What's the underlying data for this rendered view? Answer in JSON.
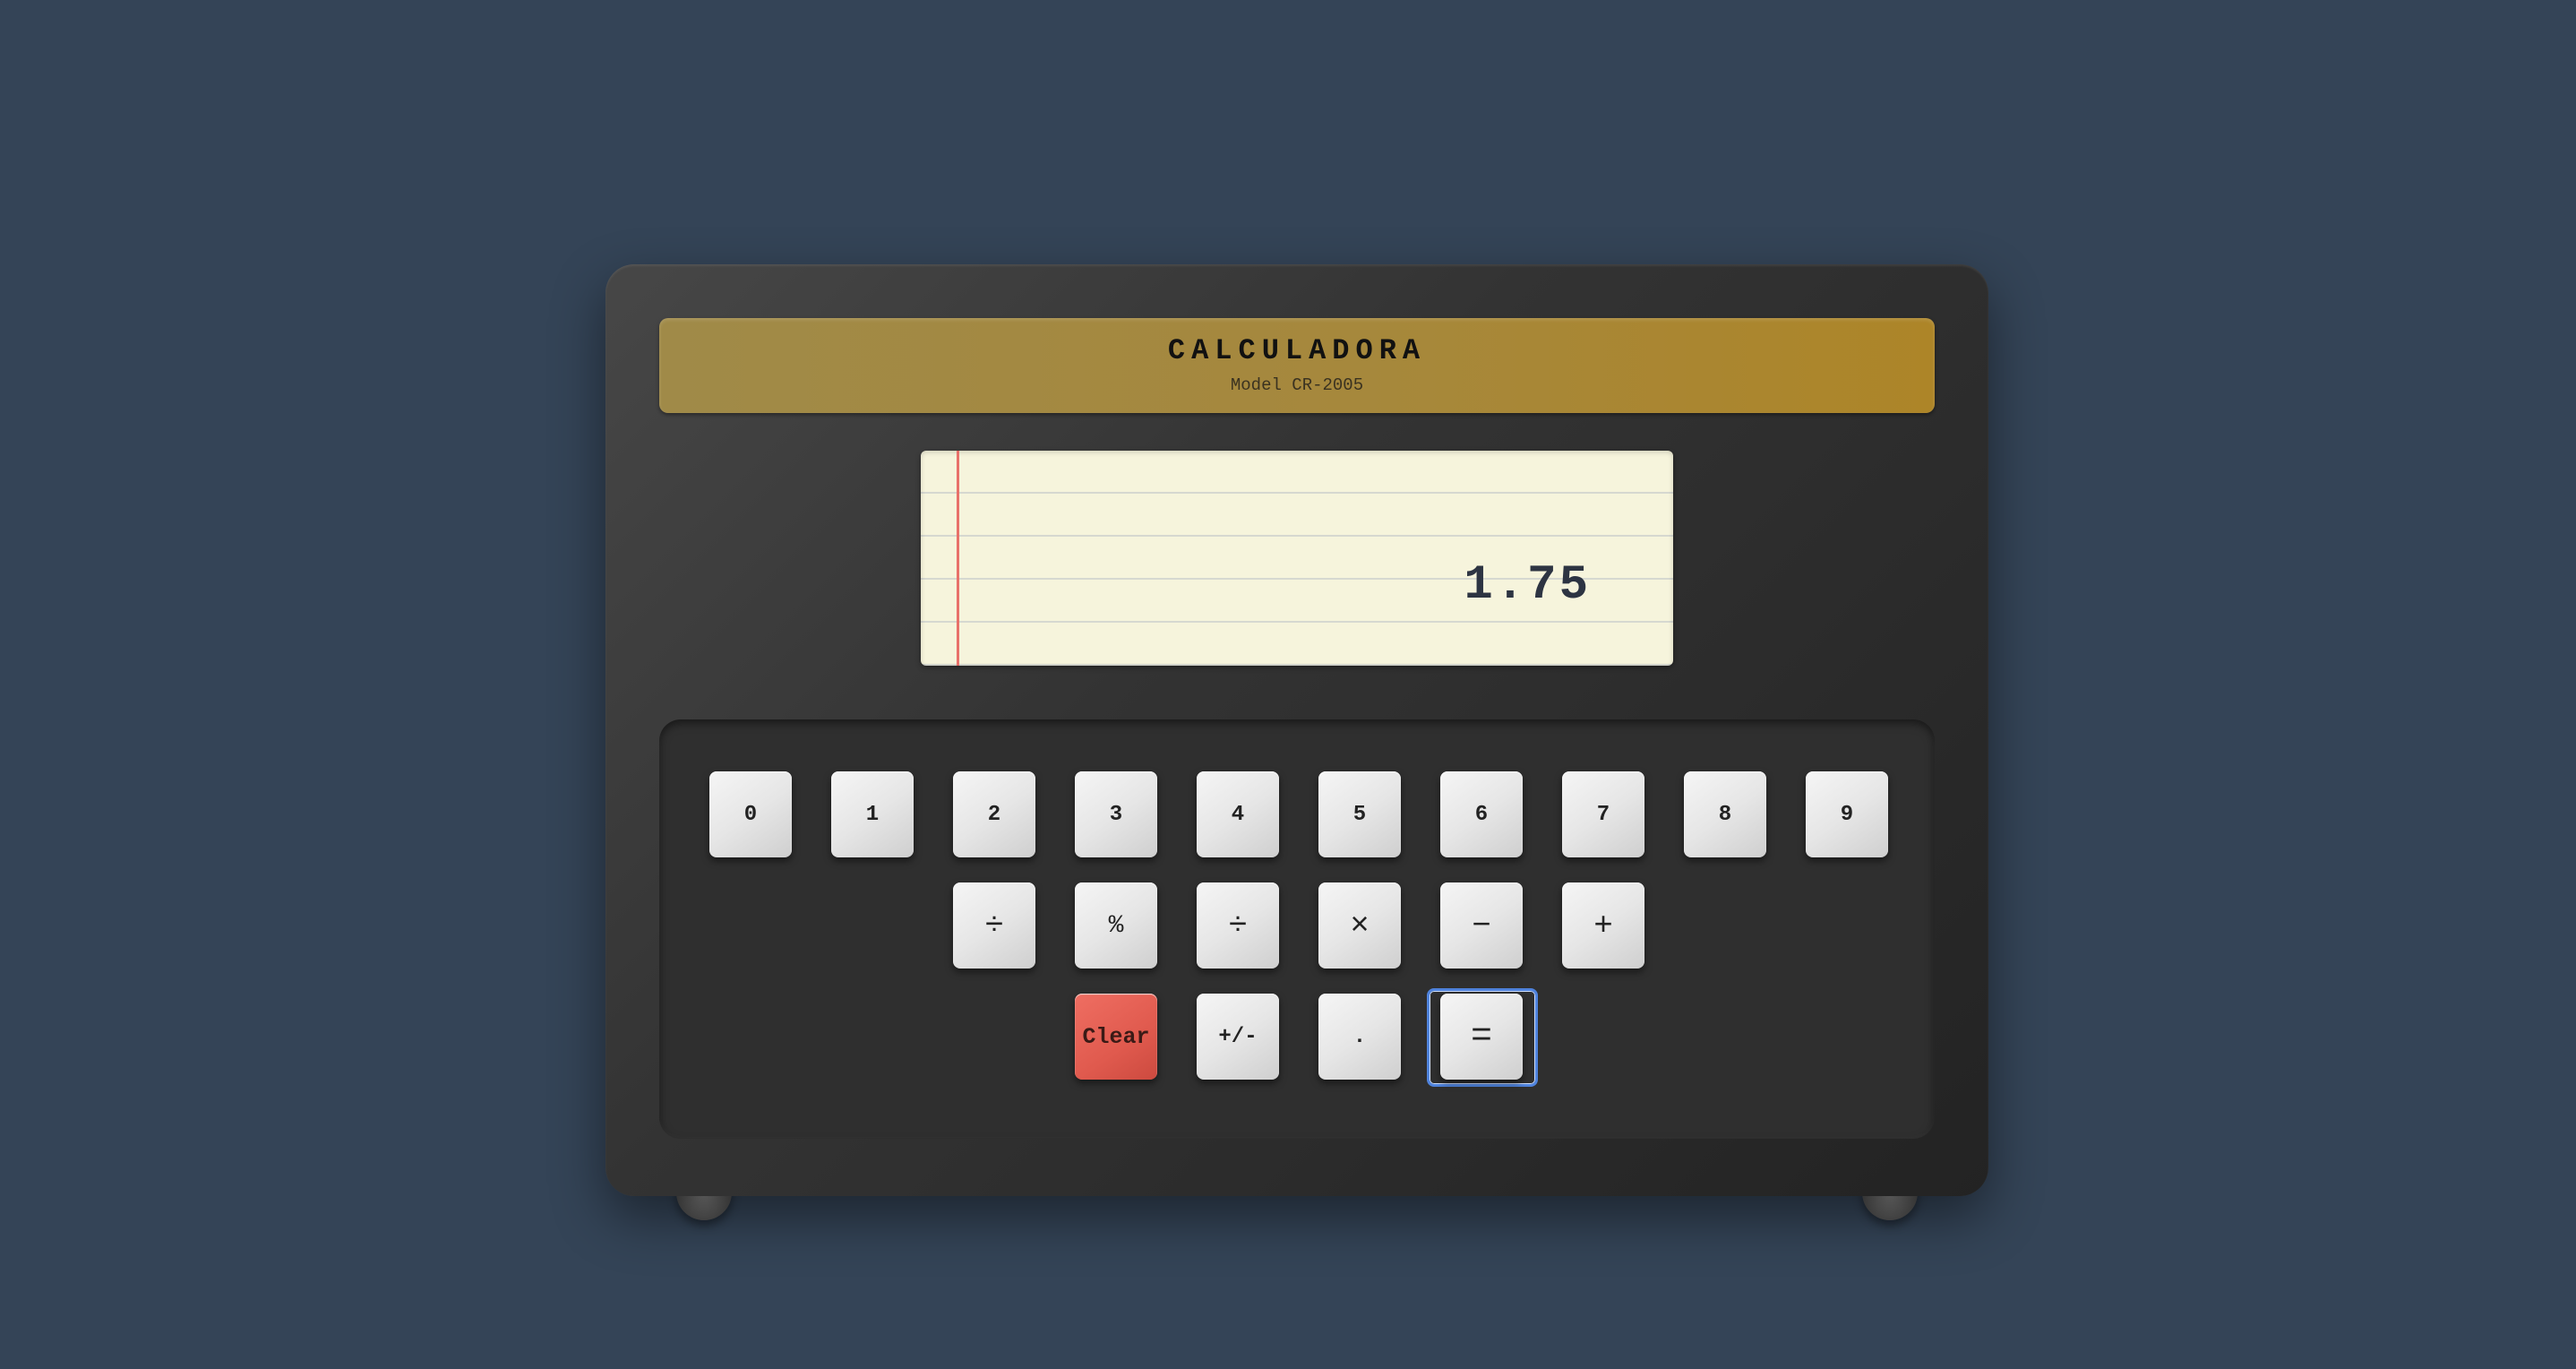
{
  "header": {
    "title": "CALCULADORA",
    "model": "Model CR-2005"
  },
  "display": {
    "value": "1.75"
  },
  "keypad": {
    "digits": [
      "0",
      "1",
      "2",
      "3",
      "4",
      "5",
      "6",
      "7",
      "8",
      "9"
    ],
    "operators": [
      "÷",
      "%",
      "÷",
      "×",
      "−",
      "+"
    ],
    "actions": {
      "clear": "Clear",
      "negate": "+/-",
      "decimal": ".",
      "equals": "="
    }
  },
  "colors": {
    "background": "#344457",
    "clear_key": "#e05a4e",
    "title_plate": "#a6883c",
    "display_paper": "#f6f4dc",
    "focus_ring": "#4f83dd"
  }
}
